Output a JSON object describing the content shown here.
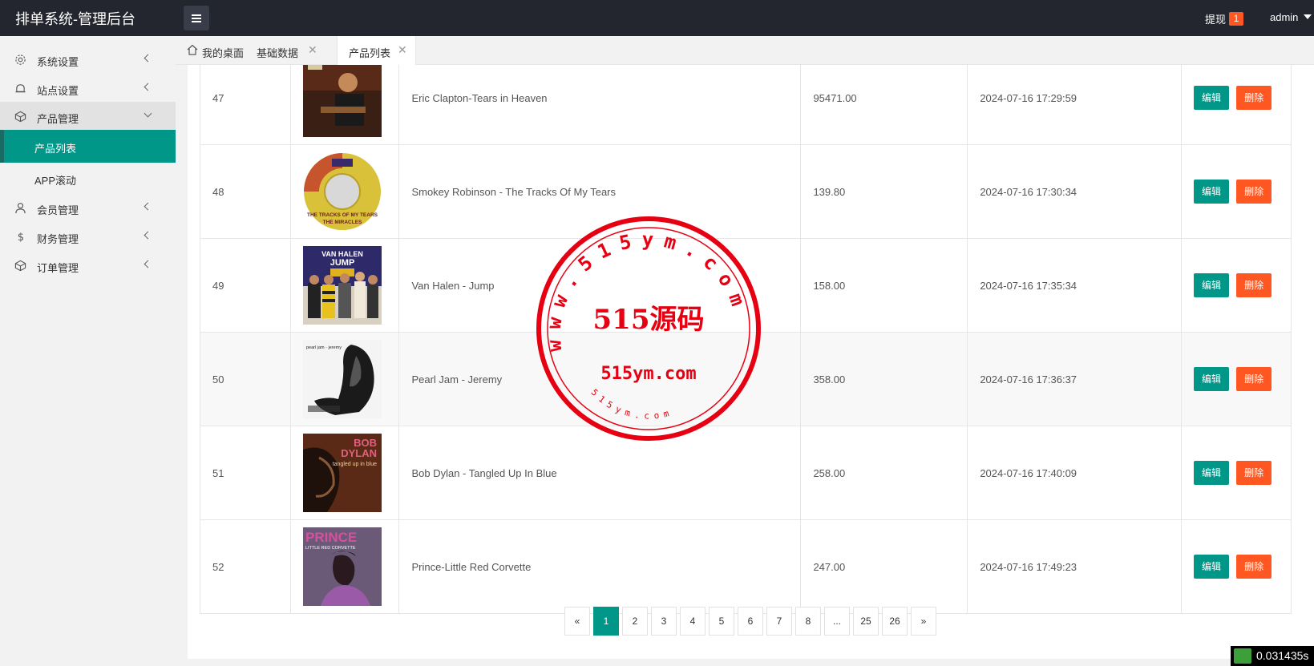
{
  "header": {
    "title": "排单系统-管理后台",
    "withdraw_label": "提现",
    "withdraw_count": "1",
    "user": "admin"
  },
  "sidebar": {
    "items": [
      {
        "label": "系统设置",
        "icon": "gear-icon"
      },
      {
        "label": "站点设置",
        "icon": "bell-icon"
      },
      {
        "label": "产品管理",
        "icon": "cube-icon"
      },
      {
        "label": "会员管理",
        "icon": "user-icon"
      },
      {
        "label": "财务管理",
        "icon": "dollar-icon"
      },
      {
        "label": "订单管理",
        "icon": "cube-icon"
      }
    ],
    "sub_items": [
      {
        "label": "产品列表"
      },
      {
        "label": "APP滚动"
      }
    ]
  },
  "tabs": [
    {
      "label": "我的桌面",
      "icon": "home-icon"
    },
    {
      "label": "基础数据"
    },
    {
      "label": "产品列表"
    }
  ],
  "table": {
    "edit_label": "编辑",
    "delete_label": "删除",
    "rows": [
      {
        "id": "47",
        "name": "Eric Clapton-Tears in Heaven",
        "price": "95471.00",
        "time": "2024-07-16 17:29:59"
      },
      {
        "id": "48",
        "name": "Smokey Robinson - The Tracks Of My Tears",
        "price": "139.80",
        "time": "2024-07-16 17:30:34"
      },
      {
        "id": "49",
        "name": "Van Halen - Jump",
        "price": "158.00",
        "time": "2024-07-16 17:35:34"
      },
      {
        "id": "50",
        "name": "Pearl Jam - Jeremy",
        "price": "358.00",
        "time": "2024-07-16 17:36:37"
      },
      {
        "id": "51",
        "name": "Bob Dylan - Tangled Up In Blue",
        "price": "258.00",
        "time": "2024-07-16 17:40:09"
      },
      {
        "id": "52",
        "name": "Prince-Little Red Corvette",
        "price": "247.00",
        "time": "2024-07-16 17:49:23"
      }
    ]
  },
  "covers": {
    "smokey_title": "THE TRACKS OF MY TEARS",
    "smokey_artist": "THE MIRACLES",
    "vanhalen_band": "VAN HALEN",
    "vanhalen_title": "JUMP",
    "pearljam_title": "pearl jam · jeremy",
    "dylan_artist_1": "BOB",
    "dylan_artist_2": "DYLAN",
    "dylan_title": "tangled up in blue",
    "prince_artist": "PRINCE",
    "prince_title": "LITTLE RED CORVETTE"
  },
  "pagination": {
    "prev": "«",
    "pages": [
      "1",
      "2",
      "3",
      "4",
      "5",
      "6",
      "7",
      "8",
      "...",
      "25",
      "26"
    ],
    "next": "»"
  },
  "watermark": {
    "ring_text": "www.515ym.com",
    "main": "515源码",
    "sub": "515ym.com",
    "bottom": "515ym.com"
  },
  "timer": "0.031435s",
  "colors": {
    "header_bg": "#23262e",
    "accent": "#009688",
    "danger": "#ff5722",
    "stamp": "#e60012"
  }
}
